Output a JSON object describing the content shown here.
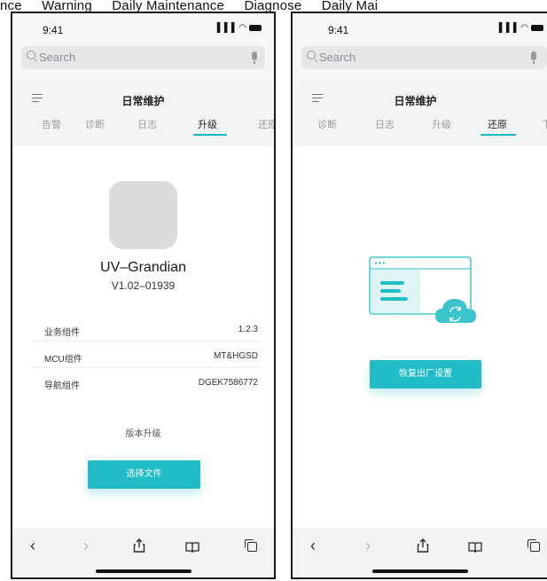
{
  "caption": [
    "nce",
    "Warning",
    "Daily Maintenance",
    "Diagnose",
    "Daily Mai"
  ],
  "status": {
    "time": "9:41",
    "signal": "▐▐▐ ◠"
  },
  "search": {
    "placeholder": "Search"
  },
  "nav": {
    "title": "日常维护"
  },
  "left": {
    "tabs": [
      "告警",
      "诊断",
      "日志",
      "升级",
      "还原"
    ],
    "active_tab": "升级",
    "app_name": "UV–Grandian",
    "app_version": "V1.02–01939",
    "components": [
      {
        "name": "业务组件",
        "value": "1.2.3"
      },
      {
        "name": "MCU组件",
        "value": "MT&HGSD"
      },
      {
        "name": "导航组件",
        "value": "DGEK7586772"
      }
    ],
    "upgrade_label": "版本升级",
    "select_file": "选择文件"
  },
  "right": {
    "tabs": [
      "诊断",
      "日志",
      "升级",
      "还原",
      "下"
    ],
    "active_tab": "还原",
    "restore_button": "恢复出厂设置"
  },
  "toolbar": {
    "back": "‹",
    "forward": "›",
    "bookmarks": "⎕"
  },
  "colors": {
    "accent": "#22bcc6",
    "illustration_light": "#dff4f5"
  },
  "icons": [
    "search-icon",
    "mic-icon",
    "menu-icon",
    "share-icon",
    "book-icon",
    "tabs-icon",
    "cloud-refresh-icon"
  ]
}
